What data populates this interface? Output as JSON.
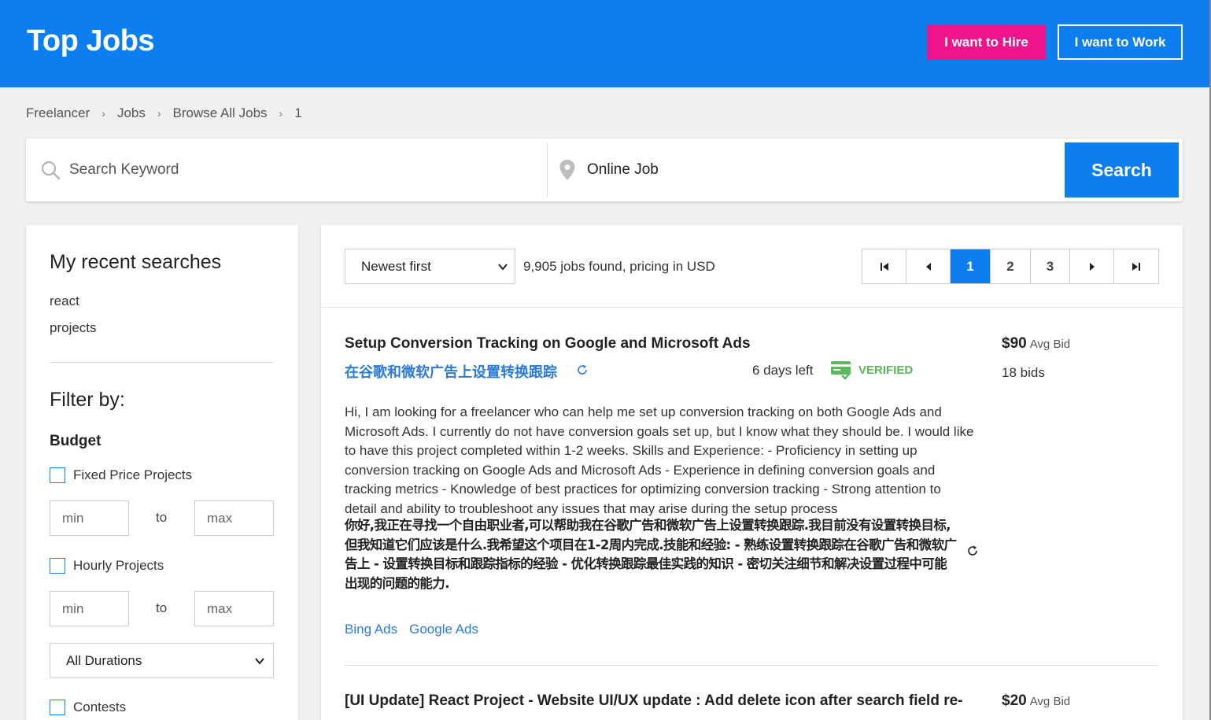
{
  "header": {
    "logo": "Top Jobs",
    "hire_label": "I want to Hire",
    "work_label": "I want to Work"
  },
  "breadcrumb": [
    "Freelancer",
    "Jobs",
    "Browse All Jobs",
    "1"
  ],
  "search": {
    "keyword_placeholder": "Search Keyword",
    "location_value": "Online Job",
    "button_label": "Search"
  },
  "sidebar": {
    "recent_title": "My recent searches",
    "recent": [
      "react",
      "projects"
    ],
    "filter_title": "Filter by:",
    "budget_title": "Budget",
    "fixed_label": "Fixed Price Projects",
    "hourly_label": "Hourly Projects",
    "min_placeholder": "min",
    "max_placeholder": "max",
    "to_label": "to",
    "duration_value": "All Durations",
    "contests_label": "Contests"
  },
  "results": {
    "sort_value": "Newest first",
    "count_text": "9,905 jobs found, pricing in USD",
    "pages": [
      "1",
      "2",
      "3"
    ],
    "current_page": "1"
  },
  "jobs": [
    {
      "title": "Setup Conversion Tracking on Google and Microsoft Ads",
      "translated_title": "在谷歌和微软广告上设置转换跟踪",
      "days_left": "6 days left",
      "verified": "VERIFIED",
      "description": "Hi, I am looking for a freelancer who can help me set up conversion tracking on both Google Ads and Microsoft Ads. I currently do not have conversion goals set up, but I know what they should be. I would like to have this project completed within 1-2 weeks. Skills and Experience: - Proficiency in setting up conversion tracking on Google Ads and Microsoft Ads - Experience in defining conversion goals and tracking metrics - Knowledge of best practices for optimizing conversion tracking - Strong attention to detail and ability to troubleshoot any issues that may arise during the setup process",
      "description_zh": "你好,我正在寻找一个自由职业者,可以帮助我在谷歌广告和微软广告上设置转换跟踪.我目前没有设置转换目标,但我知道它们应该是什么.我希望这个项目在1-2周内完成.技能和经验: - 熟练设置转换跟踪在谷歌广告和微软广告上 - 设置转换目标和跟踪指标的经验 - 优化转换跟踪最佳实践的知识 - 密切关注细节和解决设置过程中可能出现的问题的能力.",
      "tags": [
        "Bing Ads",
        "Google Ads"
      ],
      "avg_bid": "$90",
      "avg_bid_label": "Avg Bid",
      "bids": "18 bids"
    },
    {
      "title": "[UI Update] React Project - Website UI/UX update : Add delete icon after search field re-",
      "avg_bid": "$20",
      "avg_bid_label": "Avg Bid"
    }
  ]
}
